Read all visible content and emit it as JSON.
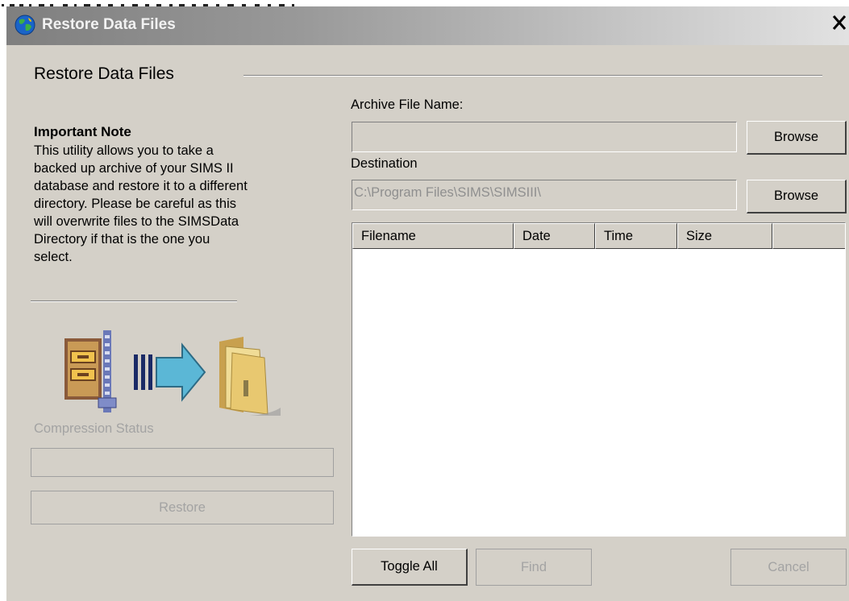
{
  "window": {
    "title": "Restore Data Files",
    "close_label": "✕"
  },
  "section": {
    "title": "Restore Data Files"
  },
  "note": {
    "title": "Important Note",
    "lines": [
      "This utility allows you to take a",
      "backed up archive of your SIMS II",
      "database and restore it to a different",
      "directory. Please be careful as this",
      "will overwrite files to the SIMSData",
      "Directory if that is the one you",
      "select."
    ]
  },
  "compression": {
    "label": "Compression Status",
    "restore_label": "Restore"
  },
  "archive": {
    "label": "Archive File Name:",
    "value": "",
    "browse_label": "Browse"
  },
  "destination": {
    "label": "Destination",
    "value": "C:\\Program Files\\SIMS\\SIMSIII\\",
    "browse_label": "Browse"
  },
  "file_list": {
    "columns": [
      "Filename",
      "Date",
      "Time",
      "Size",
      ""
    ],
    "rows": []
  },
  "buttons": {
    "toggle_all": "Toggle All",
    "find": "Find",
    "cancel": "Cancel"
  },
  "colors": {
    "window_bg": "#d4d0c8",
    "disabled_text": "#a3a3a3",
    "list_bg": "#ffffff"
  },
  "icons": {
    "title": "globe-icon",
    "archive": "zip-archive-icon",
    "arrow": "right-arrow-icon",
    "folder": "folder-icon"
  }
}
